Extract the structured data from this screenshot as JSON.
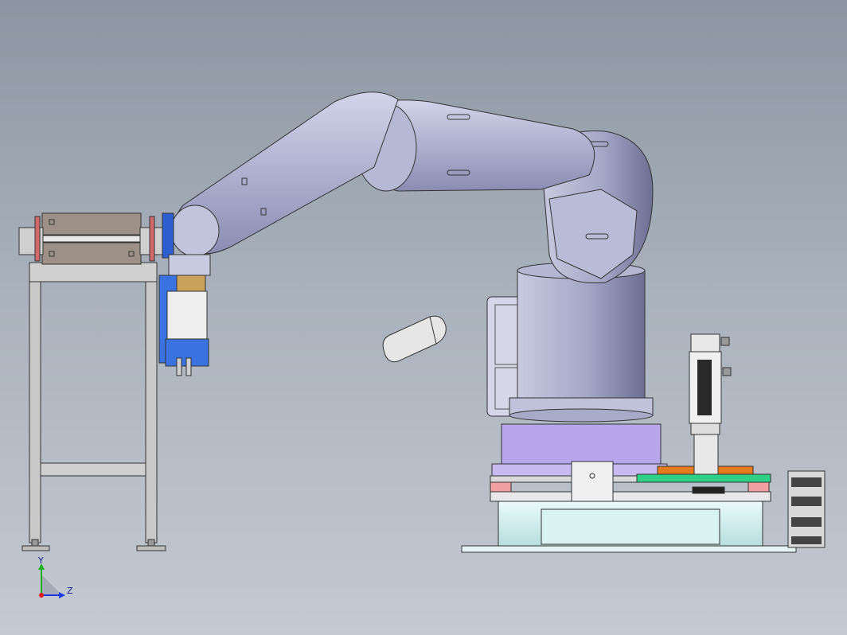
{
  "triad": {
    "y_label": "Y",
    "z_label": "Z"
  },
  "colors": {
    "background_top": "#8c95a1",
    "background_bottom": "#c4cad2",
    "robot_body": "#a5a8c6",
    "robot_edge": "#2a2a3a",
    "base_plate": "#b9a8e6",
    "rail_green": "#2ecc85",
    "rail_red": "#e8a0a0",
    "gripper_blue": "#2f6fd6",
    "gripper_brass": "#c9a15a",
    "frame_gray": "#c8c8c8",
    "roller_brown": "#a09488",
    "pedestal_cyan": "#d8f2f2",
    "axis_y": "#1fb01f",
    "axis_z": "#1a3ae0",
    "axis_x": "#e01a1a"
  }
}
